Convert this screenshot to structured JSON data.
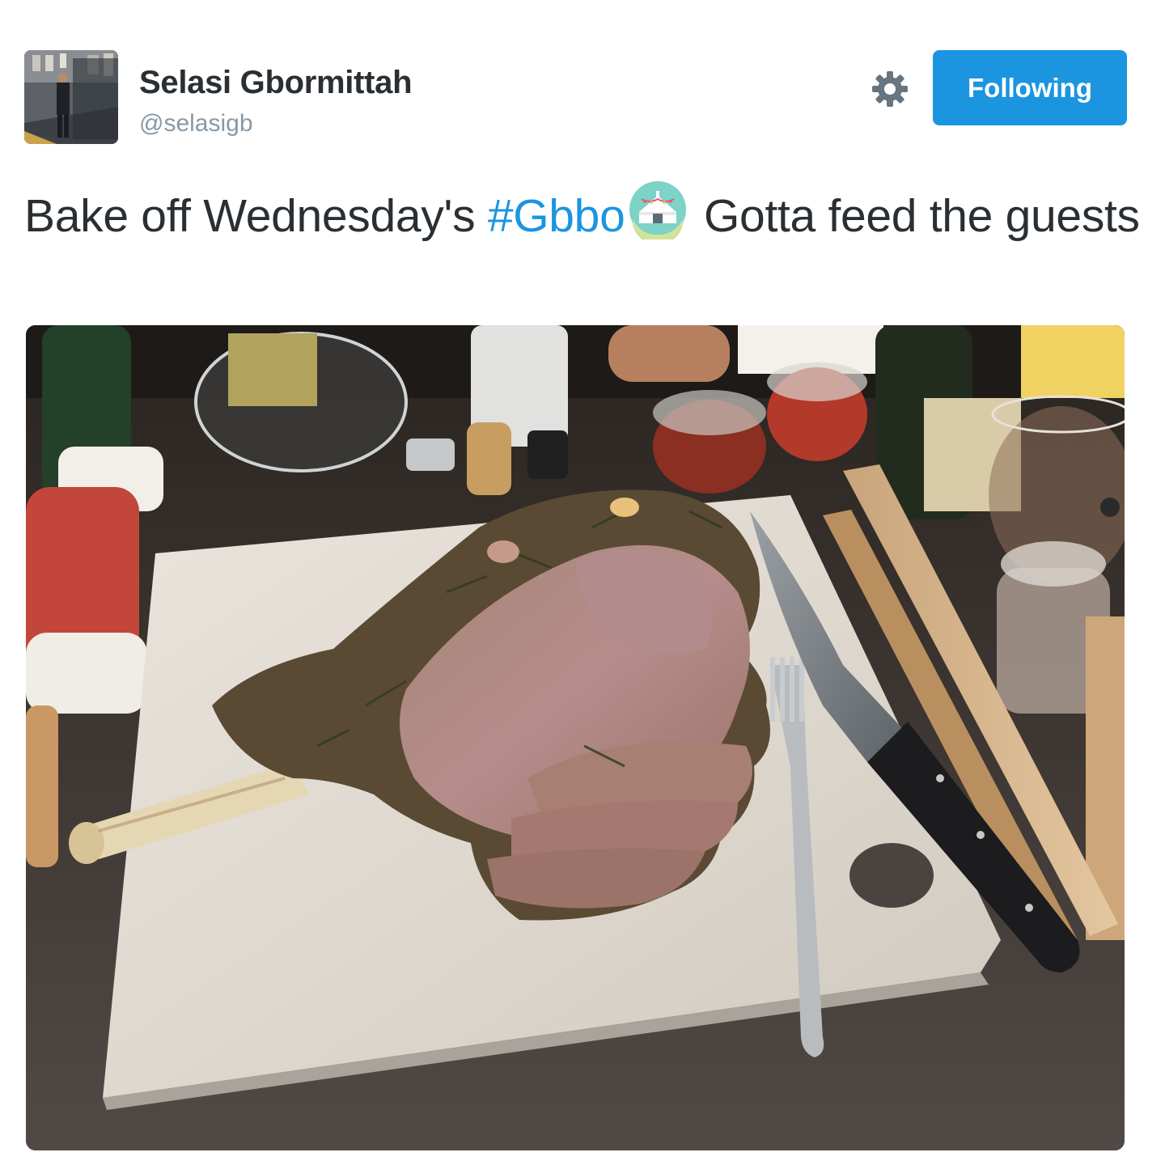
{
  "user": {
    "display_name": "Selasi Gbormittah",
    "handle": "@selasigb",
    "avatar_icon": "profile-photo"
  },
  "actions": {
    "settings_icon": "gear-icon",
    "follow_label": "Following"
  },
  "tweet": {
    "text_before": "Bake off Wednesday's ",
    "hashtag": "#Gbbo",
    "hashtag_emoji_icon": "bake-off-tent-icon",
    "text_after": " Gotta feed the guests"
  },
  "media": {
    "type": "photo",
    "subject": "roast-leg-of-lamb-on-marble-board"
  },
  "colors": {
    "accent": "#1b95e0",
    "text": "#292f33",
    "muted": "#8899a6"
  }
}
